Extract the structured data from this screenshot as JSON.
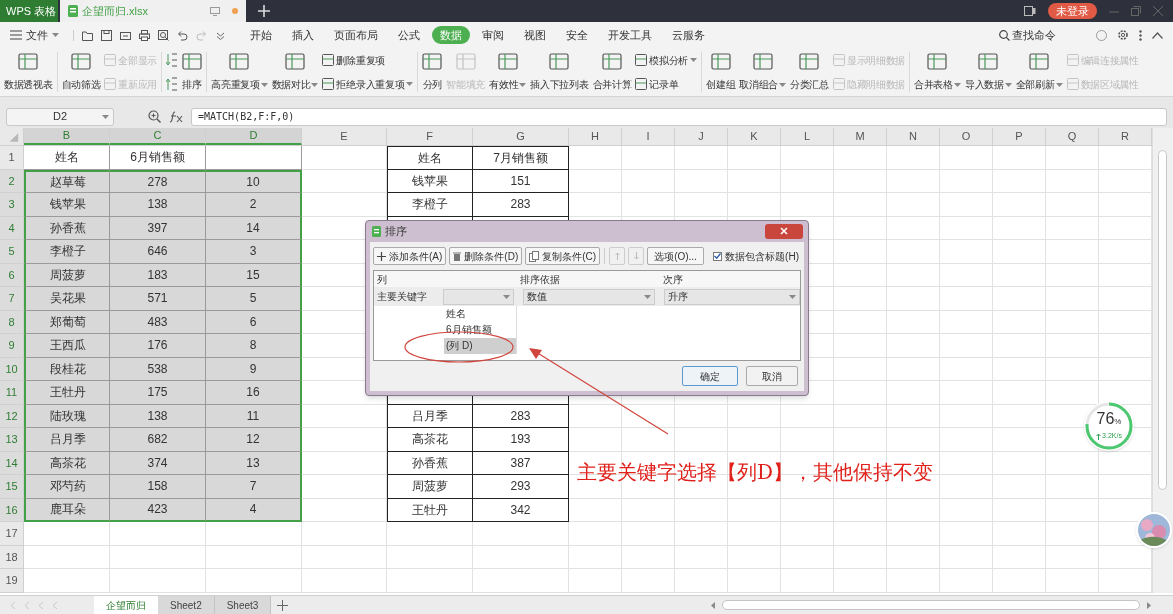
{
  "title_bar": {
    "app_tab": "WPS 表格",
    "doc_tab": "企望而归.xlsx",
    "login": "未登录"
  },
  "menu": {
    "file": "文件",
    "tabs": [
      {
        "label": "开始",
        "selected": false
      },
      {
        "label": "插入",
        "selected": false
      },
      {
        "label": "页面布局",
        "selected": false
      },
      {
        "label": "公式",
        "selected": false
      },
      {
        "label": "数据",
        "selected": true
      },
      {
        "label": "审阅",
        "selected": false
      },
      {
        "label": "视图",
        "selected": false
      },
      {
        "label": "安全",
        "selected": false
      },
      {
        "label": "开发工具",
        "selected": false
      },
      {
        "label": "云服务",
        "selected": false
      }
    ],
    "search": "查找命令"
  },
  "ribbon": [
    {
      "kind": "large",
      "label": "数据透视表",
      "disabled": false,
      "dropdown": false
    },
    {
      "kind": "separator"
    },
    {
      "kind": "large",
      "label": "自动筛选",
      "disabled": false,
      "dropdown": false
    },
    {
      "kind": "stack",
      "items": [
        {
          "label": "全部显示",
          "disabled": true,
          "dropdown": false
        },
        {
          "label": "重新应用",
          "disabled": true,
          "dropdown": false
        }
      ]
    },
    {
      "kind": "separator"
    },
    {
      "kind": "sortpair"
    },
    {
      "kind": "large",
      "label": "排序",
      "disabled": false,
      "dropdown": false
    },
    {
      "kind": "separator"
    },
    {
      "kind": "large",
      "label": "高亮重复项",
      "disabled": false,
      "dropdown": true
    },
    {
      "kind": "large",
      "label": "数据对比",
      "disabled": false,
      "dropdown": true
    },
    {
      "kind": "stack",
      "items": [
        {
          "label": "删除重复项",
          "disabled": false,
          "dropdown": false
        },
        {
          "label": "拒绝录入重复项",
          "disabled": false,
          "dropdown": true
        }
      ]
    },
    {
      "kind": "separator"
    },
    {
      "kind": "large",
      "label": "分列",
      "disabled": false,
      "dropdown": false
    },
    {
      "kind": "large",
      "label": "智能填充",
      "disabled": true,
      "dropdown": false
    },
    {
      "kind": "large",
      "label": "有效性",
      "disabled": false,
      "dropdown": true
    },
    {
      "kind": "large",
      "label": "插入下拉列表",
      "disabled": false,
      "dropdown": false
    },
    {
      "kind": "large",
      "label": "合并计算",
      "disabled": false,
      "dropdown": false
    },
    {
      "kind": "stack",
      "items": [
        {
          "label": "模拟分析",
          "disabled": false,
          "dropdown": true
        },
        {
          "label": "记录单",
          "disabled": false,
          "dropdown": false
        }
      ]
    },
    {
      "kind": "separator"
    },
    {
      "kind": "large",
      "label": "创建组",
      "disabled": false,
      "dropdown": false
    },
    {
      "kind": "large",
      "label": "取消组合",
      "disabled": false,
      "dropdown": true
    },
    {
      "kind": "large",
      "label": "分类汇总",
      "disabled": false,
      "dropdown": false
    },
    {
      "kind": "stack",
      "items": [
        {
          "label": "显示明细数据",
          "disabled": true,
          "dropdown": false
        },
        {
          "label": "隐藏明细数据",
          "disabled": true,
          "dropdown": false
        }
      ]
    },
    {
      "kind": "separator"
    },
    {
      "kind": "large",
      "label": "合并表格",
      "disabled": false,
      "dropdown": true
    },
    {
      "kind": "large",
      "label": "导入数据",
      "disabled": false,
      "dropdown": true
    },
    {
      "kind": "large",
      "label": "全部刷新",
      "disabled": false,
      "dropdown": true
    },
    {
      "kind": "stack",
      "items": [
        {
          "label": "编辑连接属性",
          "disabled": true,
          "dropdown": false
        },
        {
          "label": "数据区域属性",
          "disabled": true,
          "dropdown": false
        }
      ]
    }
  ],
  "formula_bar": {
    "name_box": "D2",
    "formula": "=MATCH(B2,F:F,0)"
  },
  "sheet": {
    "columns": [
      {
        "label": "B",
        "selected": true
      },
      {
        "label": "C",
        "selected": true
      },
      {
        "label": "D",
        "selected": true
      },
      {
        "label": "E",
        "selected": false
      },
      {
        "label": "F",
        "selected": false
      },
      {
        "label": "G",
        "selected": false
      },
      {
        "label": "H",
        "selected": false
      },
      {
        "label": "I",
        "selected": false
      },
      {
        "label": "J",
        "selected": false
      },
      {
        "label": "K",
        "selected": false
      },
      {
        "label": "L",
        "selected": false
      },
      {
        "label": "M",
        "selected": false
      },
      {
        "label": "N",
        "selected": false
      },
      {
        "label": "O",
        "selected": false
      },
      {
        "label": "P",
        "selected": false
      },
      {
        "label": "Q",
        "selected": false
      },
      {
        "label": "R",
        "selected": false
      }
    ],
    "rows": [
      {
        "number": "1",
        "selected": false,
        "left": {
          "name": "姓名",
          "sales": "6月销售额"
        },
        "right": {
          "name": "姓名",
          "sales": "7月销售额"
        }
      },
      {
        "number": "2",
        "selected": true,
        "left": {
          "name": "赵草莓",
          "sales": "278",
          "match": "10"
        },
        "right": {
          "name": "钱苹果",
          "sales": "151"
        }
      },
      {
        "number": "3",
        "selected": true,
        "left": {
          "name": "钱苹果",
          "sales": "138",
          "match": "2"
        },
        "right": {
          "name": "李橙子",
          "sales": "283"
        }
      },
      {
        "number": "4",
        "selected": true,
        "left": {
          "name": "孙香蕉",
          "sales": "397",
          "match": "14"
        }
      },
      {
        "number": "5",
        "selected": true,
        "left": {
          "name": "李橙子",
          "sales": "646",
          "match": "3"
        }
      },
      {
        "number": "6",
        "selected": true,
        "left": {
          "name": "周菠萝",
          "sales": "183",
          "match": "15"
        }
      },
      {
        "number": "7",
        "selected": true,
        "left": {
          "name": "吴花果",
          "sales": "571",
          "match": "5"
        }
      },
      {
        "number": "8",
        "selected": true,
        "left": {
          "name": "郑葡萄",
          "sales": "483",
          "match": "6"
        }
      },
      {
        "number": "9",
        "selected": true,
        "left": {
          "name": "王西瓜",
          "sales": "176",
          "match": "8"
        }
      },
      {
        "number": "10",
        "selected": true,
        "left": {
          "name": "段桂花",
          "sales": "538",
          "match": "9"
        }
      },
      {
        "number": "11",
        "selected": true,
        "left": {
          "name": "王牡丹",
          "sales": "175",
          "match": "16"
        }
      },
      {
        "number": "12",
        "selected": true,
        "left": {
          "name": "陆玫瑰",
          "sales": "138",
          "match": "11"
        },
        "right": {
          "name": "吕月季",
          "sales": "283"
        }
      },
      {
        "number": "13",
        "selected": true,
        "left": {
          "name": "吕月季",
          "sales": "682",
          "match": "12"
        },
        "right": {
          "name": "高茶花",
          "sales": "193"
        }
      },
      {
        "number": "14",
        "selected": true,
        "left": {
          "name": "高茶花",
          "sales": "374",
          "match": "13"
        },
        "right": {
          "name": "孙香蕉",
          "sales": "387"
        }
      },
      {
        "number": "15",
        "selected": true,
        "left": {
          "name": "邓芍药",
          "sales": "158",
          "match": "7"
        },
        "right": {
          "name": "周菠萝",
          "sales": "293"
        }
      },
      {
        "number": "16",
        "selected": true,
        "left": {
          "name": "鹿耳朵",
          "sales": "423",
          "match": "4"
        },
        "right": {
          "name": "王牡丹",
          "sales": "342"
        }
      },
      {
        "number": "17",
        "selected": false
      },
      {
        "number": "18",
        "selected": false
      },
      {
        "number": "19",
        "selected": false
      }
    ]
  },
  "dialog": {
    "title": "排序",
    "toolbar": [
      "添加条件(A)",
      "删除条件(D)",
      "复制条件(C)"
    ],
    "options": "选项(O)...",
    "header_checkbox": {
      "label": "数据包含标题(H)",
      "checked": true
    },
    "headers": [
      "列",
      "排序依据",
      "次序"
    ],
    "row_label": "主要关键字",
    "basis": "数值",
    "order": "升序",
    "key_options": [
      {
        "label": "姓名",
        "selected": false
      },
      {
        "label": "6月销售额",
        "selected": false
      },
      {
        "label": "(列 D)",
        "selected": true
      }
    ],
    "ok": "确定",
    "cancel": "取消"
  },
  "annotation": "主要关键字选择【列D】，其他保持不变",
  "speed_widget": {
    "percent": "76",
    "unit": "%",
    "rate": "3.2K/s"
  },
  "sheet_tabs": [
    {
      "label": "企望而归",
      "selected": true
    },
    {
      "label": "Sheet2",
      "selected": false
    },
    {
      "label": "Sheet3",
      "selected": false
    }
  ]
}
